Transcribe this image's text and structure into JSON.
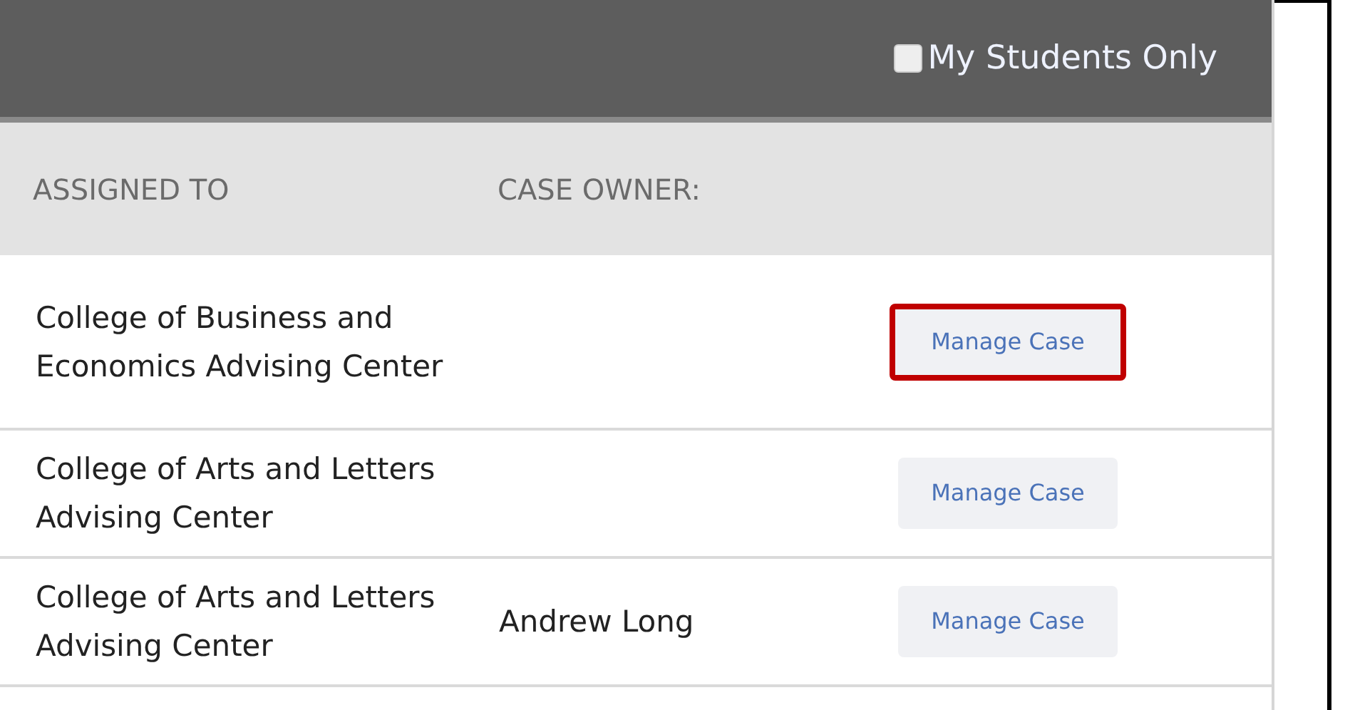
{
  "filter": {
    "label": "My Students Only",
    "checked": false
  },
  "columns": [
    "ASSIGNED TO",
    "CASE OWNER:"
  ],
  "rows": [
    {
      "assigned_to": "College of Business and Economics Advising Center",
      "case_owner": "",
      "action": "Manage Case",
      "highlighted": true
    },
    {
      "assigned_to": "College of Arts and Letters Advising Center",
      "case_owner": "",
      "action": "Manage Case",
      "highlighted": false
    },
    {
      "assigned_to": "College of Arts and Letters Advising Center",
      "case_owner": "Andrew Long",
      "action": "Manage Case",
      "highlighted": false
    }
  ]
}
